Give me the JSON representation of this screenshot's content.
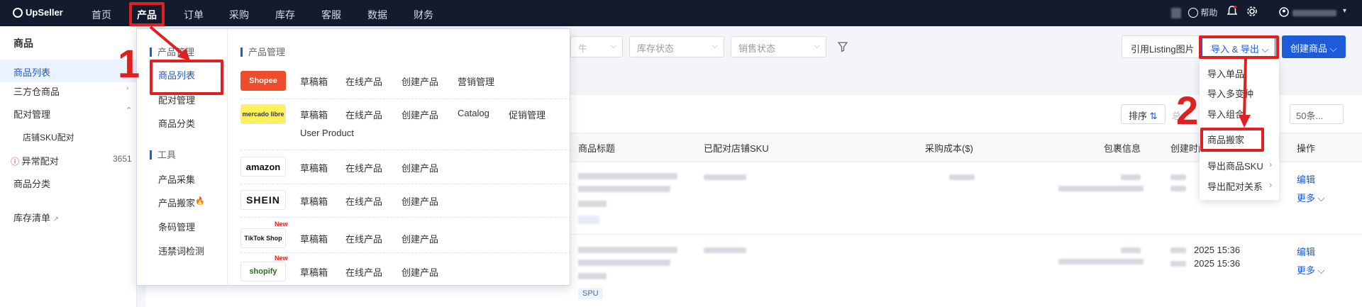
{
  "topbar": {
    "logo": "UpSeller",
    "nav": [
      "首页",
      "产品",
      "订单",
      "采购",
      "库存",
      "客服",
      "数据",
      "财务"
    ],
    "help": "帮助"
  },
  "sidebar": {
    "title": "商品",
    "items": [
      "商品列表",
      "三方仓商品",
      "配对管理",
      "店铺SKU配对",
      "异常配对",
      "商品分类",
      "库存清单"
    ],
    "abnormal_count": "3651"
  },
  "filters": [
    "库存状态",
    "销售状态"
  ],
  "toolbar": {
    "listing_btn": "引用Listing图片",
    "import_export_btn": "导入 & 导出",
    "create_btn": "创建商品"
  },
  "list_controls": {
    "sort_label": "排序",
    "page_size": "50条..."
  },
  "table": {
    "headers": [
      "商品标题",
      "已配对店铺SKU",
      "采购成本($)",
      "包裹信息",
      "创建时间",
      "操作"
    ],
    "rows": [
      {
        "time": "",
        "edit": "编辑",
        "more": "更多"
      },
      {
        "time1": "2025 15:36",
        "time2": "2025 15:36",
        "tag": "SPU",
        "edit": "编辑",
        "more": "更多"
      }
    ]
  },
  "mega_menu": {
    "left_section_1": "产品管理",
    "left_items_1": [
      "商品列表",
      "配对管理",
      "商品分类"
    ],
    "left_section_2": "工具",
    "left_items_2": [
      "产品采集",
      "产品搬家",
      "条码管理",
      "违禁词检测"
    ],
    "right_section": "产品管理",
    "platforms": [
      {
        "name": "Shopee",
        "links": [
          "草稿箱",
          "在线产品",
          "创建产品",
          "营销管理"
        ]
      },
      {
        "name": "mercado libre",
        "links": [
          "草稿箱",
          "在线产品",
          "创建产品",
          "Catalog",
          "促销管理",
          "User Product"
        ]
      },
      {
        "name": "amazon",
        "links": [
          "草稿箱",
          "在线产品",
          "创建产品"
        ]
      },
      {
        "name": "SHEIN",
        "links": [
          "草稿箱",
          "在线产品",
          "创建产品"
        ]
      },
      {
        "name": "TikTok Shop",
        "badge": "New",
        "links": [
          "草稿箱",
          "在线产品",
          "创建产品"
        ]
      },
      {
        "name": "shopify",
        "badge": "New",
        "links": [
          "草稿箱",
          "在线产品",
          "创建产品"
        ]
      }
    ]
  },
  "import_menu": {
    "items": [
      "导入单品",
      "导入多变种",
      "导入组合",
      "商品搬家",
      "导出商品SKU",
      "导出配对关系"
    ]
  },
  "annotations": {
    "step1": "1",
    "step2": "2"
  },
  "colors": {
    "topbar": "#141b2e",
    "accent": "#1d5bd8",
    "highlight": "#e02020"
  }
}
